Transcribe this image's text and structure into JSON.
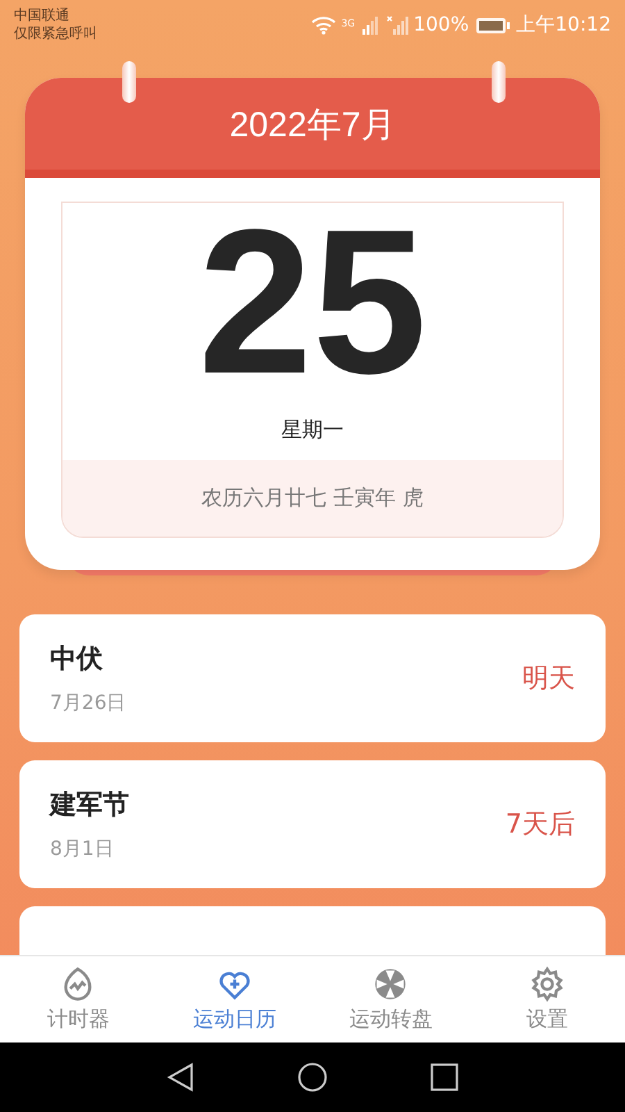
{
  "status_bar": {
    "carrier": "中国联通",
    "carrier_note": "仅限紧急呼叫",
    "network": "3G",
    "battery": "100%",
    "time": "上午10:12"
  },
  "calendar": {
    "month": "2022年7月",
    "day": "25",
    "weekday": "星期一",
    "lunar": "农历六月廿七 壬寅年 虎"
  },
  "events": [
    {
      "kind": "full",
      "name": "中伏",
      "date": "7月26日",
      "when": "明天"
    },
    {
      "kind": "full",
      "name": "建军节",
      "date": "8月1日",
      "when": "7天后"
    },
    {
      "kind": "cut"
    }
  ],
  "tabs": [
    {
      "label": "计时器",
      "selected": false
    },
    {
      "label": "运动日历",
      "selected": true
    },
    {
      "label": "运动转盘",
      "selected": false
    },
    {
      "label": "设置",
      "selected": false
    }
  ]
}
